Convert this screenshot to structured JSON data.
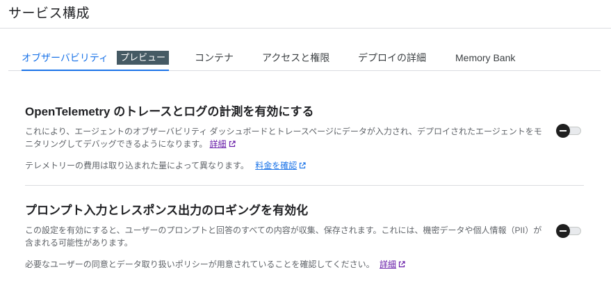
{
  "header": {
    "title": "サービス構成"
  },
  "tabs": [
    {
      "label": "オブザーバビリティ",
      "badge": "プレビュー",
      "active": true
    },
    {
      "label": "コンテナ"
    },
    {
      "label": "アクセスと権限"
    },
    {
      "label": "デプロイの詳細"
    },
    {
      "label": "Memory Bank"
    }
  ],
  "otel": {
    "heading": "OpenTelemetry のトレースとログの計測を有効にする",
    "description": "これにより、エージェントのオブザーバビリティ ダッシュボードとトレースページにデータが入力され、デプロイされたエージェントをモニタリングしてデバッグできるようになります。",
    "details_link": "詳細",
    "note": "テレメトリーの費用は取り込まれた量によって異なります。",
    "pricing_link": "料金を確認",
    "toggle_state": "off"
  },
  "prompt_logging": {
    "heading": "プロンプト入力とレスポンス出力のロギングを有効化",
    "description": "この設定を有効にすると、ユーザーのプロンプトと回答のすべての内容が収集、保存されます。これには、機密データや個人情報（PII）が含まれる可能性があります。",
    "note": "必要なユーザーの同意とデータ取り扱いポリシーが用意されていることを確認してください。",
    "details_link": "詳細",
    "toggle_state": "off"
  },
  "colors": {
    "accent": "#1a73e8",
    "visited_link": "#681da8",
    "badge_bg": "#455a64",
    "divider": "#dadce0"
  },
  "icons": [
    "external-link-icon",
    "toggle-switch-icon"
  ]
}
